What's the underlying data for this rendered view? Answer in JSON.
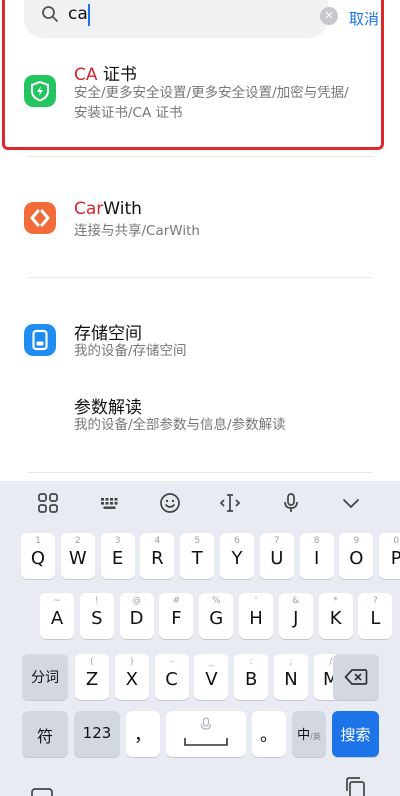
{
  "search": {
    "query": "ca",
    "cancel_label": "取消"
  },
  "results": [
    {
      "title_highlight": "CA",
      "title_rest": " 证书",
      "path_line1": "安全/更多安全设置/更多安全设置/加密与凭据/",
      "path_line2": "安装证书/CA 证书",
      "icon": "shield-bolt-icon"
    },
    {
      "title_highlight": "Car",
      "title_rest": "With",
      "path_line1": "连接与共享/CarWith",
      "icon": "carwith-icon"
    },
    {
      "title_highlight": "",
      "title_rest": "存储空间",
      "path_line1": "我的设备/存储空间",
      "icon": "storage-icon"
    },
    {
      "title_highlight": "",
      "title_rest": "参数解读",
      "path_line1": "我的设备/全部参数与信息/参数解读"
    }
  ],
  "keyboard": {
    "toolbar": [
      "grid-icon",
      "keyboard-icon",
      "emoji-icon",
      "cursor-icon",
      "microphone-icon",
      "collapse-icon"
    ],
    "row1": [
      {
        "k": "Q",
        "h": "1"
      },
      {
        "k": "W",
        "h": "2"
      },
      {
        "k": "E",
        "h": "3"
      },
      {
        "k": "R",
        "h": "4"
      },
      {
        "k": "T",
        "h": "5"
      },
      {
        "k": "Y",
        "h": "6"
      },
      {
        "k": "U",
        "h": "7"
      },
      {
        "k": "I",
        "h": "8"
      },
      {
        "k": "O",
        "h": "9"
      },
      {
        "k": "P",
        "h": "0"
      }
    ],
    "row2": [
      {
        "k": "A",
        "h": "~"
      },
      {
        "k": "S",
        "h": "!"
      },
      {
        "k": "D",
        "h": "@"
      },
      {
        "k": "F",
        "h": "#"
      },
      {
        "k": "G",
        "h": "%"
      },
      {
        "k": "H",
        "h": "'"
      },
      {
        "k": "J",
        "h": "&"
      },
      {
        "k": "K",
        "h": "*"
      },
      {
        "k": "L",
        "h": "?"
      }
    ],
    "row3": [
      {
        "k": "Z",
        "h": "("
      },
      {
        "k": "X",
        "h": ")"
      },
      {
        "k": "C",
        "h": "-"
      },
      {
        "k": "V",
        "h": "_"
      },
      {
        "k": "B",
        "h": ":"
      },
      {
        "k": "N",
        "h": ";"
      },
      {
        "k": "M",
        "h": "/"
      }
    ],
    "segment_label": "分词",
    "symbol_label": "符",
    "number_label": "123",
    "comma_label": "，",
    "period_label": "。",
    "lang_label": "中",
    "lang_sub_label": "/英",
    "search_label": "搜索"
  },
  "colors": {
    "accent": "#1a73e8",
    "highlight": "#d7242b",
    "frame": "#e0252b",
    "cert_icon": "#22c55e",
    "carwith_icon": "#f26a38",
    "storage_icon": "#1e8cf0"
  }
}
